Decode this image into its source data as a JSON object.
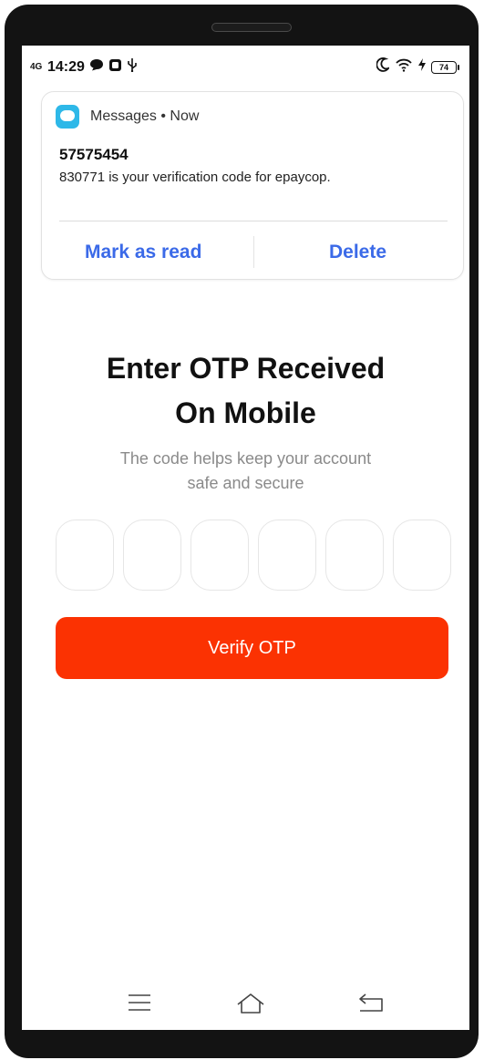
{
  "status": {
    "network": "4G",
    "time": "14:29",
    "battery": "74"
  },
  "notification": {
    "app_name": "Messages",
    "time": "Now",
    "sender": "57575454",
    "body": "830771 is your verification code for epaycop.",
    "actions": {
      "mark_read": "Mark as read",
      "delete": "Delete"
    }
  },
  "page": {
    "title_line1": "Enter OTP Received",
    "title_line2": "On Mobile",
    "subtitle_line1": "The code helps keep your account",
    "subtitle_line2": "safe and secure",
    "otp_count": 6,
    "verify_label": "Verify OTP"
  },
  "colors": {
    "accent": "#fb3202",
    "link": "#3b6ae8",
    "app_icon": "#2eb8e8"
  },
  "icons": [
    "chat-bubble-icon",
    "usb-icon",
    "moon-icon",
    "wifi-icon",
    "charging-icon",
    "menu-icon",
    "home-icon",
    "back-icon"
  ]
}
